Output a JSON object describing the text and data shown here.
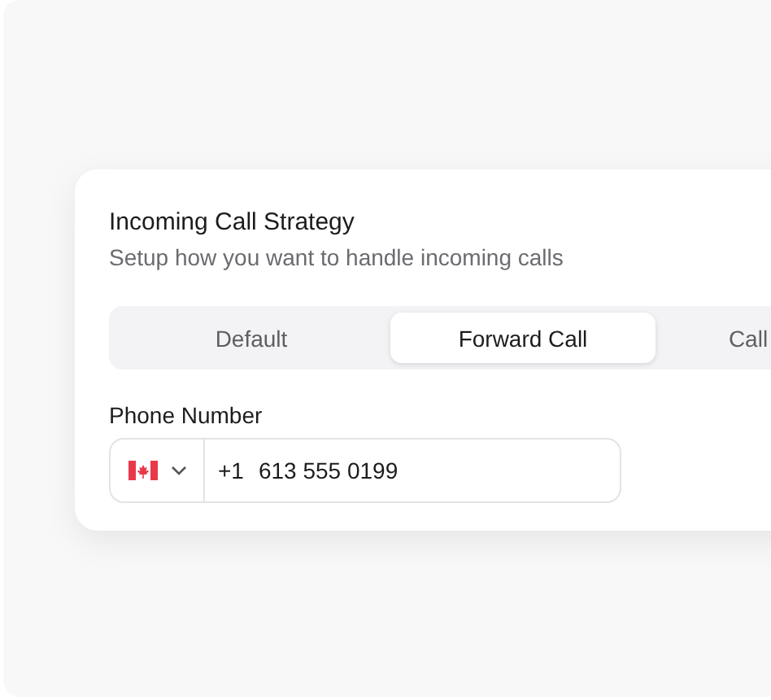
{
  "card": {
    "title": "Incoming Call Strategy",
    "subtitle": "Setup how you want to handle incoming calls"
  },
  "tabs": [
    {
      "label": "Default",
      "selected": false
    },
    {
      "label": "Forward Call",
      "selected": true
    },
    {
      "label": "Call",
      "selected": false
    }
  ],
  "phone": {
    "label": "Phone Number",
    "dial_code": "+1",
    "value": "613 555 0199"
  }
}
